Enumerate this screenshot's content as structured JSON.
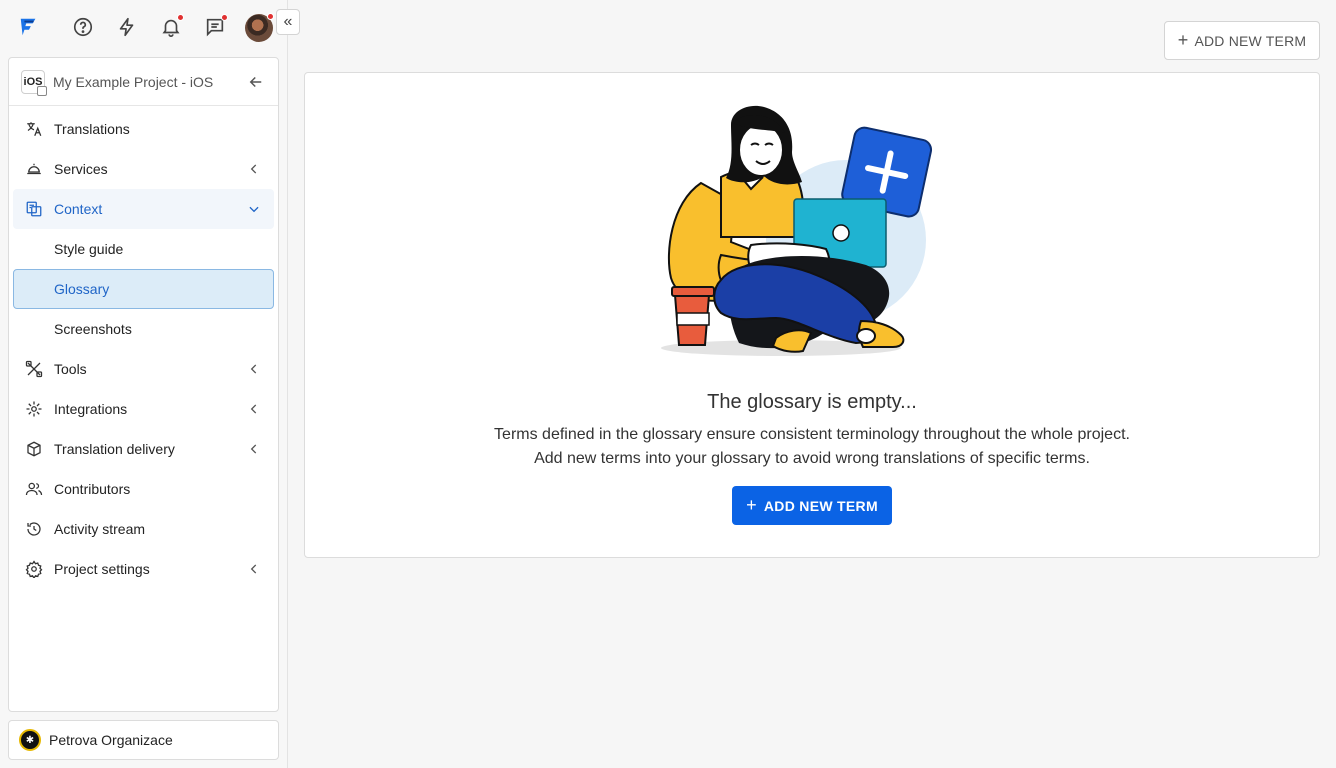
{
  "topbar": {
    "icons": [
      "logo-icon",
      "help-icon",
      "bolt-icon",
      "bell-icon",
      "messages-icon"
    ],
    "collapse_glyph": "«"
  },
  "project": {
    "icon_text": "iOS",
    "name": "My Example Project - iOS"
  },
  "nav": {
    "translations": "Translations",
    "services": "Services",
    "context": "Context",
    "style_guide": "Style guide",
    "glossary": "Glossary",
    "screenshots": "Screenshots",
    "tools": "Tools",
    "integrations": "Integrations",
    "translation_delivery": "Translation delivery",
    "contributors": "Contributors",
    "activity_stream": "Activity stream",
    "project_settings": "Project settings"
  },
  "org": {
    "name": "Petrova Organizace"
  },
  "header": {
    "add_term_label": "ADD NEW TERM"
  },
  "empty_state": {
    "title": "The glossary is empty...",
    "line1": "Terms defined in the glossary ensure consistent terminology throughout the whole project.",
    "line2": "Add new terms into your glossary to avoid wrong translations of specific terms.",
    "button_label": "ADD NEW TERM"
  },
  "colors": {
    "primary": "#0b63e5",
    "active_text": "#2065c7",
    "selected_bg": "#dcecf8",
    "notification_dot": "#e03131"
  }
}
